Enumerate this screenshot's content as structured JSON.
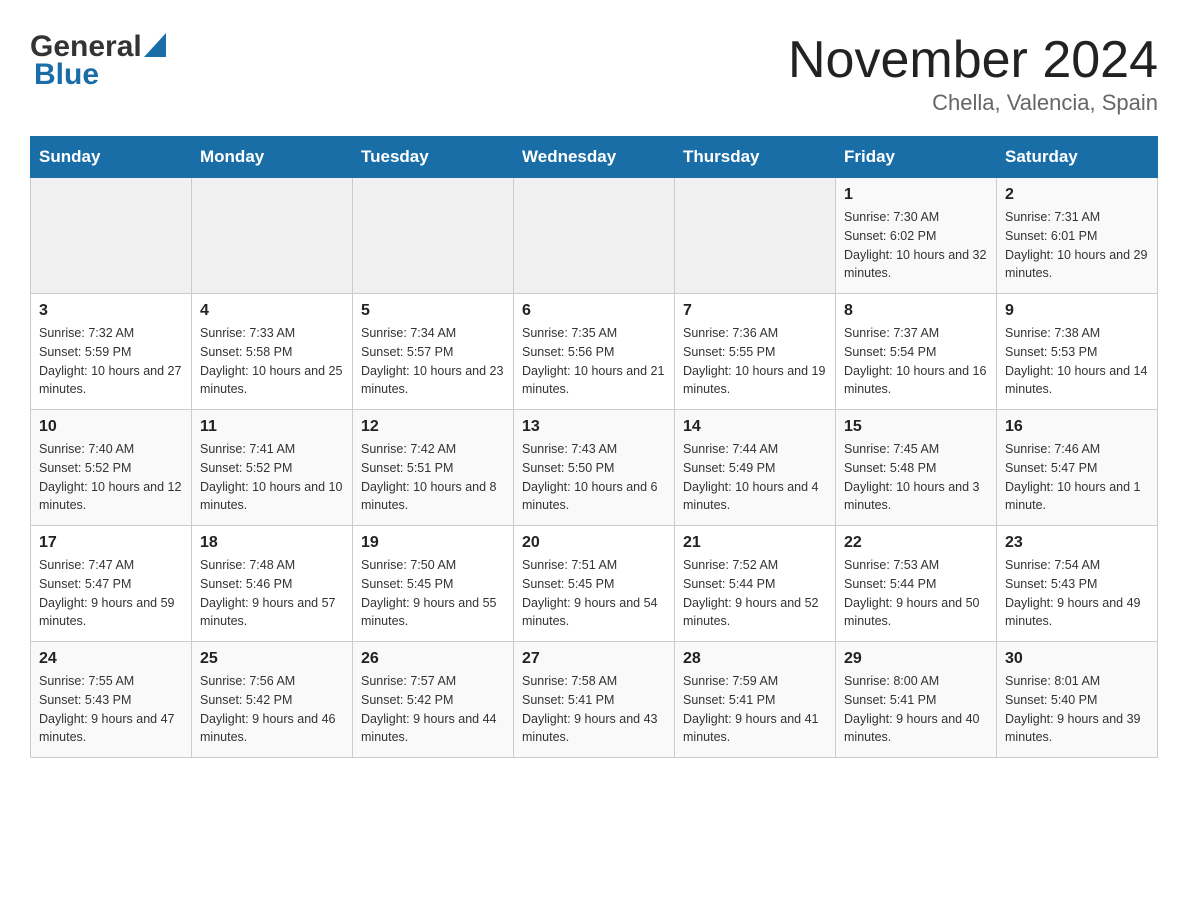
{
  "header": {
    "logo_general": "General",
    "logo_blue": "Blue",
    "month_title": "November 2024",
    "subtitle": "Chella, Valencia, Spain"
  },
  "days_of_week": [
    "Sunday",
    "Monday",
    "Tuesday",
    "Wednesday",
    "Thursday",
    "Friday",
    "Saturday"
  ],
  "weeks": [
    [
      {
        "day": "",
        "sunrise": "",
        "sunset": "",
        "daylight": ""
      },
      {
        "day": "",
        "sunrise": "",
        "sunset": "",
        "daylight": ""
      },
      {
        "day": "",
        "sunrise": "",
        "sunset": "",
        "daylight": ""
      },
      {
        "day": "",
        "sunrise": "",
        "sunset": "",
        "daylight": ""
      },
      {
        "day": "",
        "sunrise": "",
        "sunset": "",
        "daylight": ""
      },
      {
        "day": "1",
        "sunrise": "Sunrise: 7:30 AM",
        "sunset": "Sunset: 6:02 PM",
        "daylight": "Daylight: 10 hours and 32 minutes."
      },
      {
        "day": "2",
        "sunrise": "Sunrise: 7:31 AM",
        "sunset": "Sunset: 6:01 PM",
        "daylight": "Daylight: 10 hours and 29 minutes."
      }
    ],
    [
      {
        "day": "3",
        "sunrise": "Sunrise: 7:32 AM",
        "sunset": "Sunset: 5:59 PM",
        "daylight": "Daylight: 10 hours and 27 minutes."
      },
      {
        "day": "4",
        "sunrise": "Sunrise: 7:33 AM",
        "sunset": "Sunset: 5:58 PM",
        "daylight": "Daylight: 10 hours and 25 minutes."
      },
      {
        "day": "5",
        "sunrise": "Sunrise: 7:34 AM",
        "sunset": "Sunset: 5:57 PM",
        "daylight": "Daylight: 10 hours and 23 minutes."
      },
      {
        "day": "6",
        "sunrise": "Sunrise: 7:35 AM",
        "sunset": "Sunset: 5:56 PM",
        "daylight": "Daylight: 10 hours and 21 minutes."
      },
      {
        "day": "7",
        "sunrise": "Sunrise: 7:36 AM",
        "sunset": "Sunset: 5:55 PM",
        "daylight": "Daylight: 10 hours and 19 minutes."
      },
      {
        "day": "8",
        "sunrise": "Sunrise: 7:37 AM",
        "sunset": "Sunset: 5:54 PM",
        "daylight": "Daylight: 10 hours and 16 minutes."
      },
      {
        "day": "9",
        "sunrise": "Sunrise: 7:38 AM",
        "sunset": "Sunset: 5:53 PM",
        "daylight": "Daylight: 10 hours and 14 minutes."
      }
    ],
    [
      {
        "day": "10",
        "sunrise": "Sunrise: 7:40 AM",
        "sunset": "Sunset: 5:52 PM",
        "daylight": "Daylight: 10 hours and 12 minutes."
      },
      {
        "day": "11",
        "sunrise": "Sunrise: 7:41 AM",
        "sunset": "Sunset: 5:52 PM",
        "daylight": "Daylight: 10 hours and 10 minutes."
      },
      {
        "day": "12",
        "sunrise": "Sunrise: 7:42 AM",
        "sunset": "Sunset: 5:51 PM",
        "daylight": "Daylight: 10 hours and 8 minutes."
      },
      {
        "day": "13",
        "sunrise": "Sunrise: 7:43 AM",
        "sunset": "Sunset: 5:50 PM",
        "daylight": "Daylight: 10 hours and 6 minutes."
      },
      {
        "day": "14",
        "sunrise": "Sunrise: 7:44 AM",
        "sunset": "Sunset: 5:49 PM",
        "daylight": "Daylight: 10 hours and 4 minutes."
      },
      {
        "day": "15",
        "sunrise": "Sunrise: 7:45 AM",
        "sunset": "Sunset: 5:48 PM",
        "daylight": "Daylight: 10 hours and 3 minutes."
      },
      {
        "day": "16",
        "sunrise": "Sunrise: 7:46 AM",
        "sunset": "Sunset: 5:47 PM",
        "daylight": "Daylight: 10 hours and 1 minute."
      }
    ],
    [
      {
        "day": "17",
        "sunrise": "Sunrise: 7:47 AM",
        "sunset": "Sunset: 5:47 PM",
        "daylight": "Daylight: 9 hours and 59 minutes."
      },
      {
        "day": "18",
        "sunrise": "Sunrise: 7:48 AM",
        "sunset": "Sunset: 5:46 PM",
        "daylight": "Daylight: 9 hours and 57 minutes."
      },
      {
        "day": "19",
        "sunrise": "Sunrise: 7:50 AM",
        "sunset": "Sunset: 5:45 PM",
        "daylight": "Daylight: 9 hours and 55 minutes."
      },
      {
        "day": "20",
        "sunrise": "Sunrise: 7:51 AM",
        "sunset": "Sunset: 5:45 PM",
        "daylight": "Daylight: 9 hours and 54 minutes."
      },
      {
        "day": "21",
        "sunrise": "Sunrise: 7:52 AM",
        "sunset": "Sunset: 5:44 PM",
        "daylight": "Daylight: 9 hours and 52 minutes."
      },
      {
        "day": "22",
        "sunrise": "Sunrise: 7:53 AM",
        "sunset": "Sunset: 5:44 PM",
        "daylight": "Daylight: 9 hours and 50 minutes."
      },
      {
        "day": "23",
        "sunrise": "Sunrise: 7:54 AM",
        "sunset": "Sunset: 5:43 PM",
        "daylight": "Daylight: 9 hours and 49 minutes."
      }
    ],
    [
      {
        "day": "24",
        "sunrise": "Sunrise: 7:55 AM",
        "sunset": "Sunset: 5:43 PM",
        "daylight": "Daylight: 9 hours and 47 minutes."
      },
      {
        "day": "25",
        "sunrise": "Sunrise: 7:56 AM",
        "sunset": "Sunset: 5:42 PM",
        "daylight": "Daylight: 9 hours and 46 minutes."
      },
      {
        "day": "26",
        "sunrise": "Sunrise: 7:57 AM",
        "sunset": "Sunset: 5:42 PM",
        "daylight": "Daylight: 9 hours and 44 minutes."
      },
      {
        "day": "27",
        "sunrise": "Sunrise: 7:58 AM",
        "sunset": "Sunset: 5:41 PM",
        "daylight": "Daylight: 9 hours and 43 minutes."
      },
      {
        "day": "28",
        "sunrise": "Sunrise: 7:59 AM",
        "sunset": "Sunset: 5:41 PM",
        "daylight": "Daylight: 9 hours and 41 minutes."
      },
      {
        "day": "29",
        "sunrise": "Sunrise: 8:00 AM",
        "sunset": "Sunset: 5:41 PM",
        "daylight": "Daylight: 9 hours and 40 minutes."
      },
      {
        "day": "30",
        "sunrise": "Sunrise: 8:01 AM",
        "sunset": "Sunset: 5:40 PM",
        "daylight": "Daylight: 9 hours and 39 minutes."
      }
    ]
  ]
}
